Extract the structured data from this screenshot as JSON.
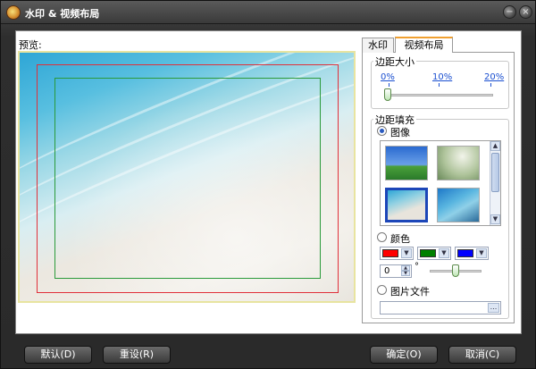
{
  "window": {
    "title": "水印 & 视频布局",
    "minimize_glyph": "−",
    "close_glyph": "×"
  },
  "preview": {
    "label": "预览:"
  },
  "tabs": [
    {
      "label": "水印",
      "active": false
    },
    {
      "label": "视频布局",
      "active": true
    }
  ],
  "margin_size": {
    "title": "边距大小",
    "marks": [
      "0%",
      "10%",
      "20%"
    ],
    "value_percent": 0
  },
  "margin_fill": {
    "title": "边距填充",
    "selected": "image",
    "image_option": "图像",
    "color_option": "颜色",
    "file_option": "图片文件",
    "thumbnails": [
      "green-hills",
      "foggy-forest",
      "beach-selected",
      "underwater-blue"
    ],
    "selected_thumbnail_index": 2,
    "colors": [
      "#ff0000",
      "#008000",
      "#0000ff"
    ],
    "rotation_value": "0",
    "degree_symbol": "°",
    "file_path": "",
    "browse_label": "..."
  },
  "icons": {
    "app": "app-logo-icon",
    "minimize": "minimize-icon",
    "close": "close-icon",
    "dropdown": "chevron-down-icon",
    "scroll_up": "arrow-up-icon",
    "scroll_down": "arrow-down-icon",
    "spin_up": "spin-up-icon",
    "spin_down": "spin-down-icon"
  },
  "buttons": {
    "default": "默认(D)",
    "reset": "重设(R)",
    "ok": "确定(O)",
    "cancel": "取消(C)"
  },
  "colors": {
    "preview_border": "#e8e4a0",
    "outer_margin_rect": "#e0303a",
    "inner_margin_rect": "#2a9a3a",
    "active_tab_accent": "#f0a030",
    "link_blue": "#1a4fd0"
  }
}
